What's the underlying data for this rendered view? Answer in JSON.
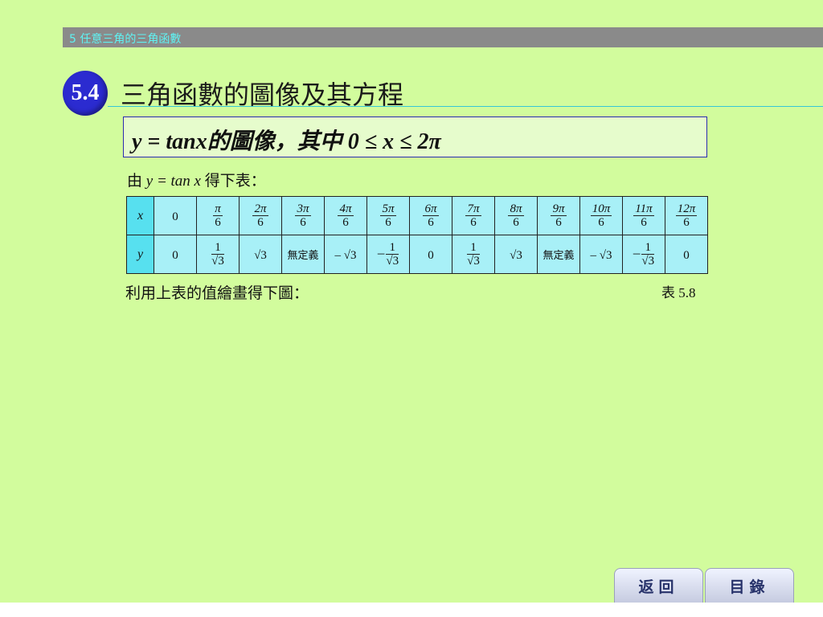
{
  "header": {
    "chapter": "5 任意三角的三角函數"
  },
  "section": {
    "number": "5.4",
    "title": "三角函數的圖像及其方程"
  },
  "subtitle": "y = tanx的圖像，其中 0 ≤  x ≤  2π",
  "intro": {
    "prefix": "由 ",
    "formula": "y = tan x",
    "suffix": " 得下表："
  },
  "table": {
    "row_headers": [
      "x",
      "y"
    ],
    "x_values": [
      {
        "type": "plain",
        "text": "0"
      },
      {
        "type": "frac",
        "num": "π",
        "den": "6"
      },
      {
        "type": "frac",
        "num": "2π",
        "den": "6"
      },
      {
        "type": "frac",
        "num": "3π",
        "den": "6"
      },
      {
        "type": "frac",
        "num": "4π",
        "den": "6"
      },
      {
        "type": "frac",
        "num": "5π",
        "den": "6"
      },
      {
        "type": "frac",
        "num": "6π",
        "den": "6"
      },
      {
        "type": "frac",
        "num": "7π",
        "den": "6"
      },
      {
        "type": "frac",
        "num": "8π",
        "den": "6"
      },
      {
        "type": "frac",
        "num": "9π",
        "den": "6"
      },
      {
        "type": "frac",
        "num": "10π",
        "den": "6"
      },
      {
        "type": "frac",
        "num": "11π",
        "den": "6"
      },
      {
        "type": "frac",
        "num": "12π",
        "den": "6"
      }
    ],
    "y_values": [
      {
        "type": "plain",
        "text": "0"
      },
      {
        "type": "frac",
        "num": "1",
        "den": "√3"
      },
      {
        "type": "plain",
        "text": "√3"
      },
      {
        "type": "undef",
        "text": "無定義"
      },
      {
        "type": "plain",
        "text": "– √3"
      },
      {
        "type": "negfrac",
        "sign": "–",
        "num": "1",
        "den": "√3"
      },
      {
        "type": "plain",
        "text": "0"
      },
      {
        "type": "frac",
        "num": "1",
        "den": "√3"
      },
      {
        "type": "plain",
        "text": "√3"
      },
      {
        "type": "undef",
        "text": "無定義"
      },
      {
        "type": "plain",
        "text": "– √3"
      },
      {
        "type": "negfrac",
        "sign": "–",
        "num": "1",
        "den": "√3"
      },
      {
        "type": "plain",
        "text": "0"
      }
    ]
  },
  "note": "利用上表的值繪畫得下圖：",
  "caption": "表 5.8",
  "buttons": {
    "back": "返回",
    "contents": "目錄"
  }
}
